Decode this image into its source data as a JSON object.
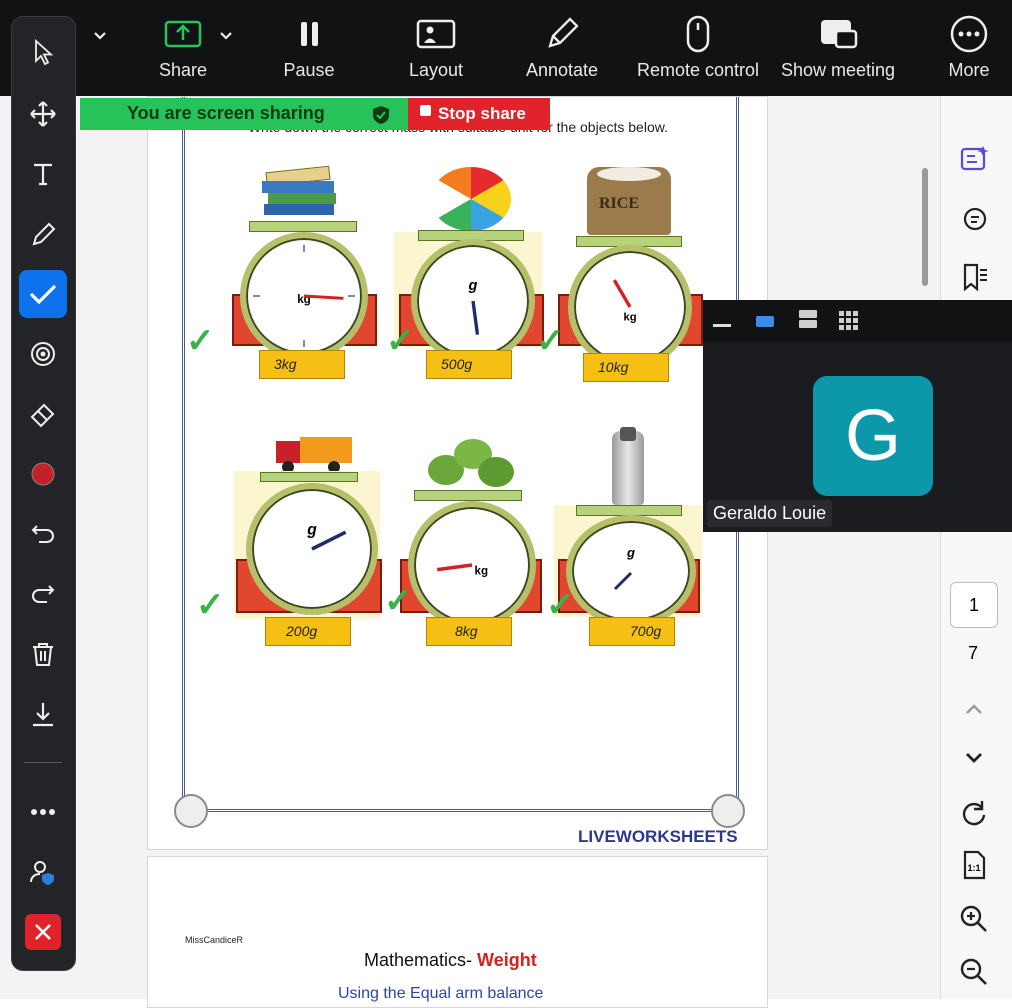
{
  "toolbar": {
    "share": "Share",
    "pause": "Pause",
    "layout": "Layout",
    "annotate": "Annotate",
    "remote_control": "Remote control",
    "show_meeting": "Show meeting",
    "more": "More"
  },
  "banner": {
    "status": "You are screen sharing",
    "stop": "Stop share"
  },
  "worksheet": {
    "instruction": "Write down the correct mass with suitable unit for the objects below.",
    "answers": [
      "3kg",
      "500g",
      "10kg",
      "200g",
      "8kg",
      "700g"
    ],
    "rice_label": "RICE",
    "brand": "LIVEWORKSHEETS",
    "author": "MissCandiceR",
    "page2_title_prefix": "Mathematics- ",
    "page2_title_accent": "Weight",
    "page2_subtitle": "Using the Equal arm balance"
  },
  "video": {
    "initial": "G",
    "name": "Geraldo Louie"
  },
  "rail": {
    "page_current": "1",
    "page_total": "7"
  },
  "colors": {
    "share_green": "#27c35a",
    "stop_red": "#e0232a",
    "accent_blue": "#0e72ed",
    "avatar_teal": "#0d98aa"
  },
  "icons": {
    "annotation_tools": [
      "select-icon",
      "move-icon",
      "text-icon",
      "pen-icon",
      "check-icon",
      "spotlight-icon",
      "eraser-icon",
      "color-icon",
      "undo-icon",
      "redo-icon",
      "trash-icon",
      "save-icon",
      "more-icon",
      "participant-icon",
      "close-icon"
    ]
  }
}
